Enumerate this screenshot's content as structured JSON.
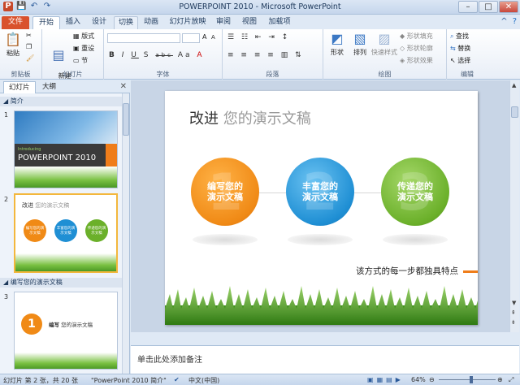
{
  "window": {
    "title": "POWERPOINT 2010 - Microsoft PowerPoint",
    "controls": {
      "minimize": "–",
      "maximize": "□",
      "close": "✕"
    }
  },
  "qat": {
    "save": "💾",
    "undo": "↶",
    "redo": "↷"
  },
  "tabs": [
    {
      "label": "文件"
    },
    {
      "label": "开始"
    },
    {
      "label": "插入"
    },
    {
      "label": "设计"
    },
    {
      "label": "切换"
    },
    {
      "label": "动画"
    },
    {
      "label": "幻灯片放映"
    },
    {
      "label": "审阅"
    },
    {
      "label": "视图"
    },
    {
      "label": "加载项"
    }
  ],
  "ribbon": {
    "clipboard": {
      "paste": "粘贴",
      "group": "剪贴板"
    },
    "slides": {
      "new_slide": "新建\n幻灯片",
      "layout": "版式",
      "reset": "重设",
      "section": "节",
      "group": "幻灯片"
    },
    "font": {
      "group": "字体",
      "bold": "B",
      "italic": "I",
      "underline": "U",
      "shadow": "S",
      "strike": "abc",
      "grow": "A",
      "shrink": "A",
      "case": "Aa"
    },
    "paragraph": {
      "group": "段落"
    },
    "drawing": {
      "shapes": "形状",
      "arrange": "排列",
      "quick_styles": "快速样式",
      "fill": "形状填充",
      "outline": "形状轮廓",
      "effects": "形状效果",
      "group": "绘图"
    },
    "editing": {
      "find": "查找",
      "replace": "替换",
      "select": "选择",
      "group": "编辑"
    }
  },
  "left_pane": {
    "tab_slides": "幻灯片",
    "tab_outline": "大纲",
    "close": "✕",
    "section1": "简介",
    "section2": "编写您的演示文稿",
    "slide1": {
      "num": "1",
      "caption": "POWERPOINT 2010",
      "small": "Introducing"
    },
    "slide2": {
      "num": "2",
      "title": "改进",
      "subtitle": "您的演示文稿",
      "c1": "编写您的演示文稿",
      "c2": "丰富您的演示文稿",
      "c3": "传递您的演示文稿"
    },
    "slide3": {
      "num": "3",
      "num_in_circle": "1",
      "title": "编写",
      "subtitle": "您的演示文稿"
    }
  },
  "slide": {
    "title_main": "改进",
    "title_sub": " 您的演示文稿",
    "circles": [
      {
        "num": "1",
        "line1": "编写您的",
        "line2": "演示文稿",
        "color": "#f08a16"
      },
      {
        "num": "2",
        "line1": "丰富您的",
        "line2": "演示文稿",
        "color": "#1f8fd4"
      },
      {
        "num": "3",
        "line1": "传递您的",
        "line2": "演示文稿",
        "color": "#6bb02a"
      }
    ],
    "slogan": "该方式的每一步都独具特点"
  },
  "notes": {
    "placeholder": "单击此处添加备注"
  },
  "status": {
    "slide_info": "幻灯片 第 2 张，共 20 张",
    "theme": "\"PowerPoint 2010 简介\"",
    "language": "中文(中国)",
    "zoom": "64%"
  }
}
